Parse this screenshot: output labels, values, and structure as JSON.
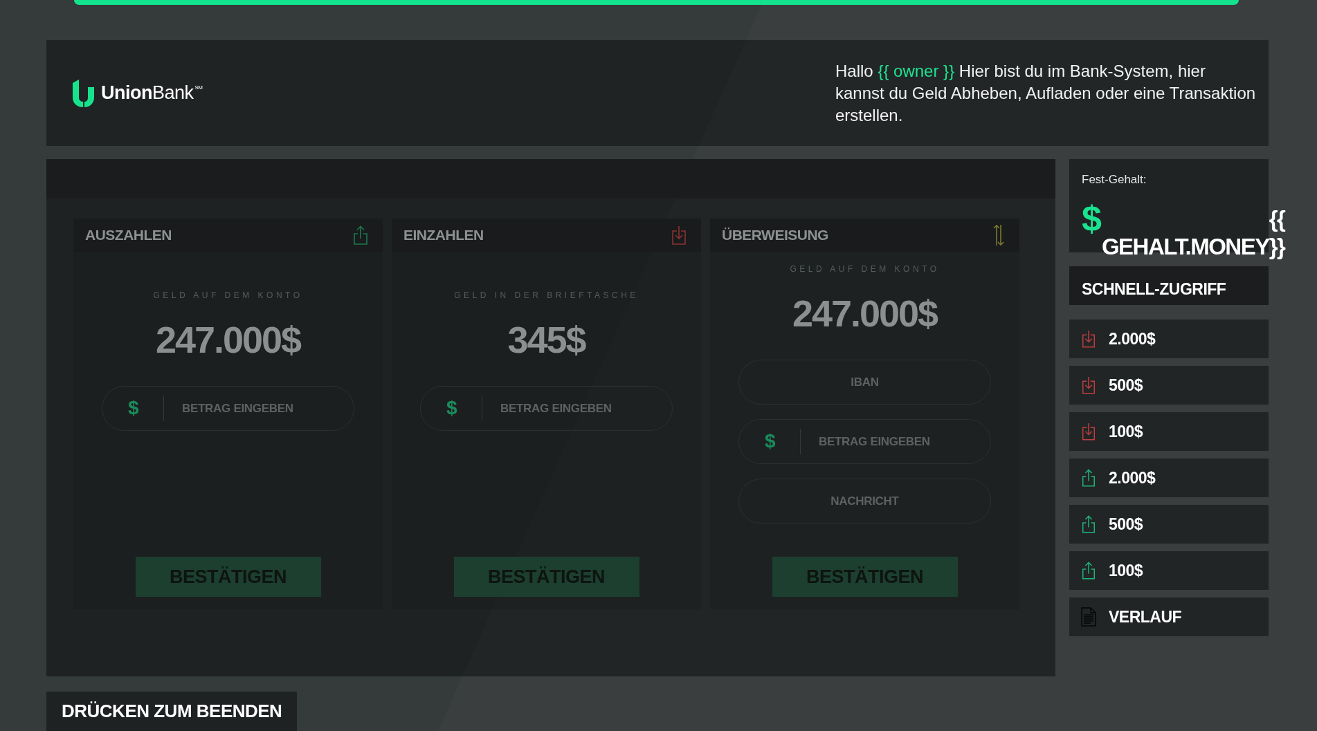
{
  "header": {
    "logo": "**Union**Bank$^{SM}$",
    "greeting": [
      {
        "text": "Hallo",
        "highlight": false
      },
      {
        "text": "{{ owner }}",
        "highlight": true
      },
      {
        "text": "Hier bist du im Bank-System, hier kannst du Geld Abheben, Aufladen oder eine Transaktion erstellen.",
        "highlight": false
      }
    ]
  },
  "cards": [
    {
      "kind": "withdraw",
      "title": "AUSZAHLEN",
      "balance_label": "GELD AUF DEM KONTO",
      "balance": "247.000$",
      "fields": [
        {
          "kind": "amount",
          "prefix": "$",
          "placeholder": "BETRAG EINGEBEN"
        }
      ],
      "button": "BESTÄTIGEN"
    },
    {
      "kind": "deposit",
      "title": "EINZAHLEN",
      "balance_label": "GELD IN DER BRIEFTASCHE",
      "balance": "345$",
      "fields": [
        {
          "kind": "amount",
          "prefix": "$",
          "placeholder": "BETRAG EINGEBEN"
        }
      ],
      "button": "BESTÄTIGEN"
    },
    {
      "kind": "transfer",
      "title": "ÜBERWEISUNG",
      "balance_label": "GELD AUF DEM KONTO",
      "balance": "247.000$",
      "fields": [
        {
          "kind": "text",
          "placeholder": "IBAN"
        },
        {
          "kind": "amount",
          "prefix": "$",
          "placeholder": "BETRAG EINGEBEN"
        },
        {
          "kind": "text",
          "placeholder": "NACHRICHT"
        }
      ],
      "button": "BESTÄTIGEN"
    }
  ],
  "salary": {
    "label": "Fest-Gehalt:",
    "currency": "$",
    "value": "{{ GEHALT.MONEY}}"
  },
  "quick_access": {
    "title": "SCHNELL-ZUGRIFF",
    "items": [
      {
        "kind": "deposit",
        "label": "2.000$"
      },
      {
        "kind": "deposit",
        "label": "500$"
      },
      {
        "kind": "deposit",
        "label": "100$"
      },
      {
        "kind": "withdraw",
        "label": "2.000$"
      },
      {
        "kind": "withdraw",
        "label": "500$"
      },
      {
        "kind": "withdraw",
        "label": "100$"
      },
      {
        "kind": "history",
        "label": "VERLAUF"
      }
    ]
  },
  "exit_button": "DRÜCKEN ZUM BEENDEN"
}
